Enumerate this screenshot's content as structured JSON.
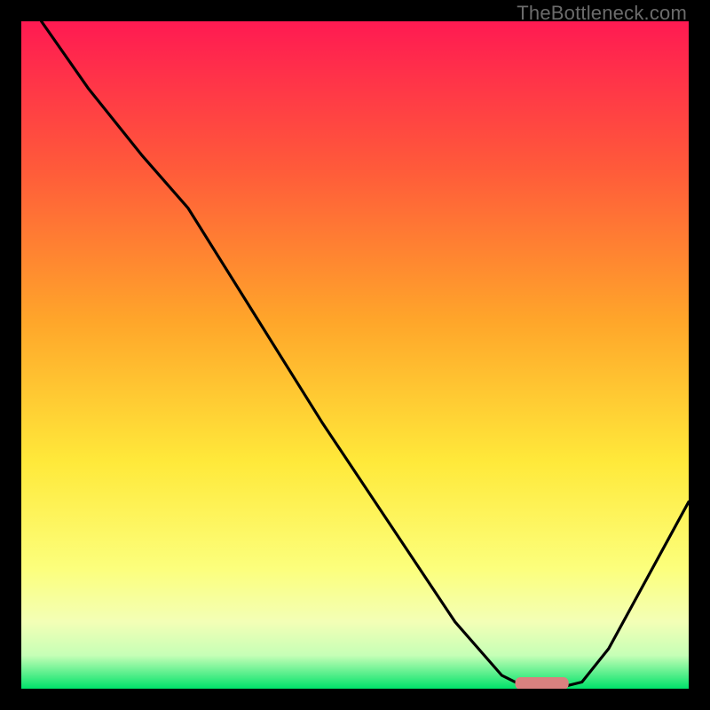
{
  "watermark": "TheBottleneck.com",
  "chart_data": {
    "type": "line",
    "title": "",
    "xlabel": "",
    "ylabel": "",
    "xlim": [
      0,
      100
    ],
    "ylim": [
      0,
      100
    ],
    "grid": false,
    "legend": false,
    "series": [
      {
        "name": "bottleneck-curve",
        "x": [
          3,
          10,
          18,
          25,
          35,
          45,
          55,
          65,
          72,
          76,
          80,
          84,
          88,
          100
        ],
        "values": [
          100,
          90,
          80,
          72,
          56,
          40,
          25,
          10,
          2,
          0,
          0,
          1,
          6,
          28
        ]
      }
    ],
    "marker": {
      "name": "bottleneck-marker",
      "x_range": [
        74,
        82
      ],
      "y": 0.8,
      "color": "#d9817f"
    },
    "gradient_stops": [
      {
        "offset": 0,
        "color": "#ff1a52"
      },
      {
        "offset": 0.22,
        "color": "#ff5a3a"
      },
      {
        "offset": 0.45,
        "color": "#ffa62a"
      },
      {
        "offset": 0.66,
        "color": "#ffe93a"
      },
      {
        "offset": 0.82,
        "color": "#fcff7c"
      },
      {
        "offset": 0.9,
        "color": "#f3ffb6"
      },
      {
        "offset": 0.95,
        "color": "#c6ffb6"
      },
      {
        "offset": 1.0,
        "color": "#00e26a"
      }
    ]
  }
}
